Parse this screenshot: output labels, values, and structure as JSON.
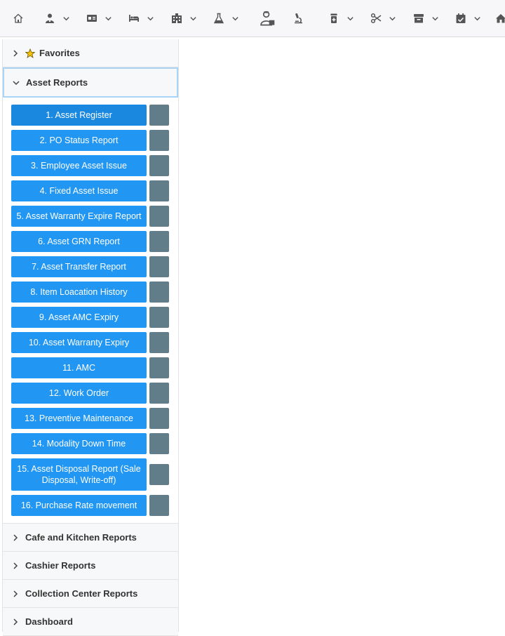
{
  "toolbar": {
    "items": [
      {
        "icon": "home-icon",
        "caret": false
      },
      {
        "icon": "user-icon",
        "caret": true
      },
      {
        "icon": "id-card-icon",
        "caret": true
      },
      {
        "icon": "bed-icon",
        "caret": true
      },
      {
        "icon": "building-icon",
        "caret": true
      },
      {
        "icon": "flask-icon",
        "caret": true
      },
      {
        "icon": "doctor-icon",
        "caret": false
      },
      {
        "icon": "microscope-icon",
        "caret": false
      },
      {
        "icon": "medicine-icon",
        "caret": true
      },
      {
        "icon": "scissors-icon",
        "caret": true
      },
      {
        "icon": "store-icon",
        "caret": true
      },
      {
        "icon": "calendar-check-icon",
        "caret": true
      },
      {
        "icon": "house-icon",
        "caret": false
      }
    ]
  },
  "sidebar": {
    "favorites_label": "Favorites",
    "asset_reports_label": "Asset Reports",
    "asset_reports": [
      "1. Asset Register",
      "2. PO Status Report",
      "3. Employee Asset Issue",
      "4. Fixed Asset Issue",
      "5. Asset Warranty Expire Report",
      "6. Asset GRN Report",
      "7. Asset Transfer Report",
      "8. Item Loacation History",
      "9. Asset AMC Expiry",
      "10. Asset Warranty Expiry",
      "11. AMC",
      "12. Work Order",
      "13. Preventive Maintenance",
      "14. Modality Down Time",
      "15. Asset Disposal Report (Sale Disposal, Write-off)",
      "16. Purchase Rate movement"
    ],
    "sections": [
      "Cafe and Kitchen Reports",
      "Cashier Reports",
      "Collection Center Reports",
      "Dashboard"
    ]
  },
  "colors": {
    "button": "#2196f3",
    "button_side": "#617d8a",
    "active_border": "#a9d4f5"
  }
}
